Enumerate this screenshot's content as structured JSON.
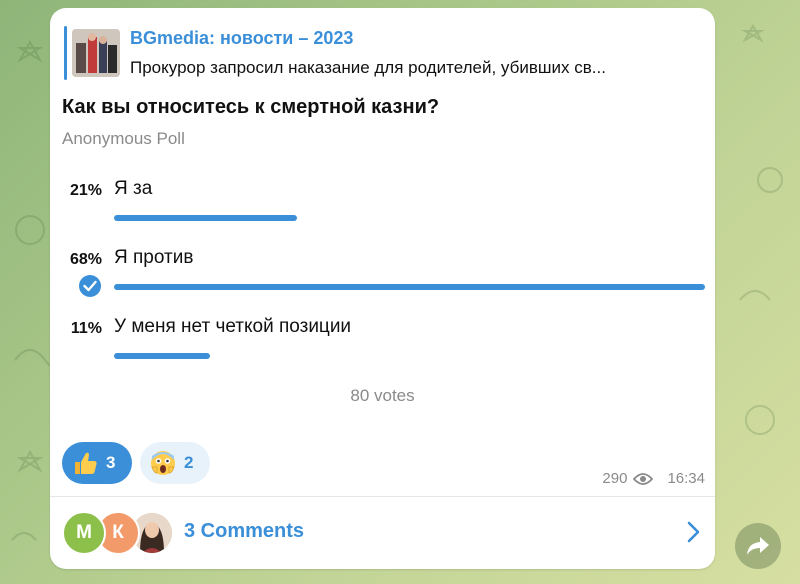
{
  "post": {
    "reply": {
      "channel": "BGmedia: новости – 2023",
      "text": "Прокурор запросил наказание для родителей, убивших св..."
    },
    "poll": {
      "question": "Как вы относитесь к смертной казни?",
      "type": "Anonymous Poll",
      "options": [
        {
          "percent": "21%",
          "label": "Я за",
          "fraction": 0.21,
          "chosen": false
        },
        {
          "percent": "68%",
          "label": "Я против",
          "fraction": 0.68,
          "chosen": true
        },
        {
          "percent": "11%",
          "label": "У меня нет четкой позиции",
          "fraction": 0.11,
          "chosen": false
        }
      ],
      "votes": "80 votes"
    },
    "reactions": [
      {
        "emoji_icon": "thumbs-up-icon",
        "count": "3",
        "mine": true
      },
      {
        "emoji_icon": "screaming-face-icon",
        "count": "2",
        "mine": false
      }
    ],
    "meta": {
      "views": "290",
      "time": "16:34"
    },
    "comments": {
      "label": "3 Comments",
      "avatars": [
        {
          "initial": "М",
          "color": "#8cc04a"
        },
        {
          "initial": "К",
          "color": "#f29a6a"
        },
        {
          "initial": "",
          "color": "#d9c5b4"
        }
      ]
    }
  },
  "colors": {
    "accent": "#3a8fd8",
    "muted": "#8a8a8a"
  }
}
